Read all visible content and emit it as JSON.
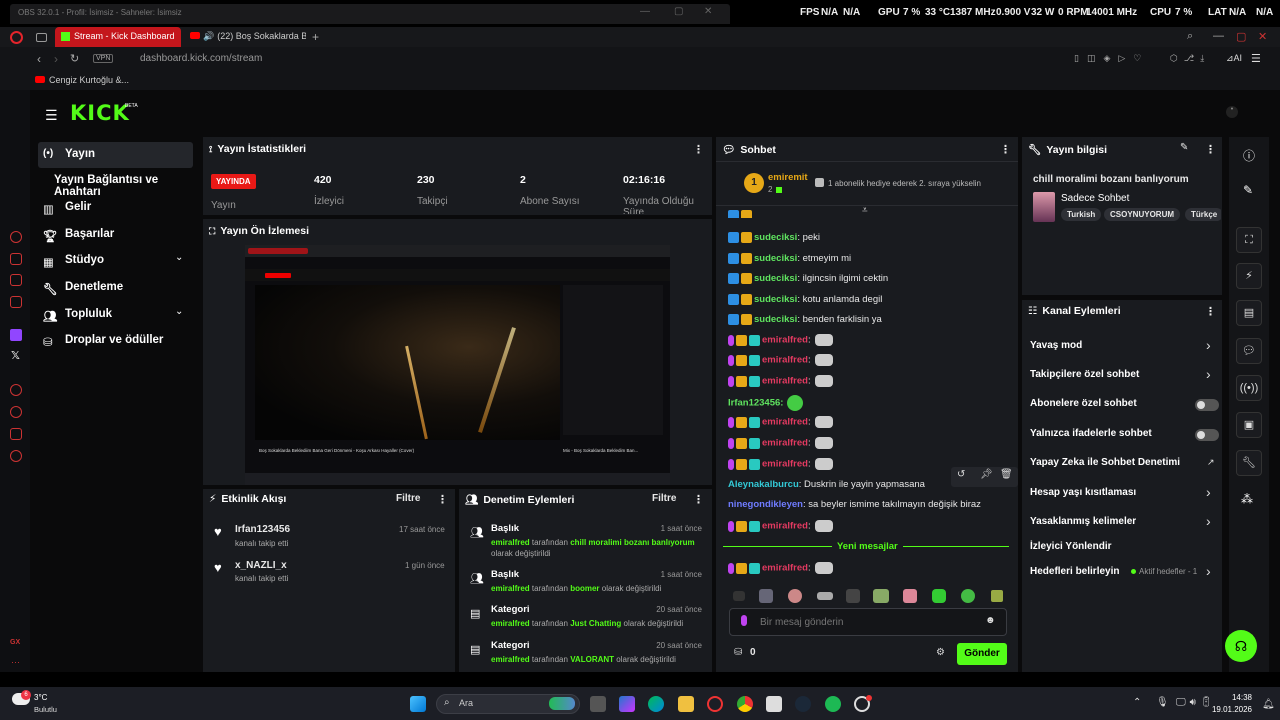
{
  "obs": {
    "title": "OBS 32.0.1 - Profil: İsimsiz - Sahneler: İsimsiz",
    "fps_label": "FPS",
    "fps_val": "N/A",
    "fps_val2": "N/A",
    "gpu_label": "GPU",
    "gpu_pct": "7 %",
    "gpu_temp": "33 °C",
    "gpu_mhz": "1387 MHz",
    "gpu_v": "0.900 V",
    "gpu_w": "32 W",
    "gpu_rpm": "0 RPM",
    "gpu_mhz2": "14001 MHz",
    "cpu_label": "CPU",
    "cpu_pct": "7 %",
    "lat_label": "LAT",
    "lat_val": "N/A",
    "lat_val2": "N/A"
  },
  "browser": {
    "tab1": "Stream - Kick Dashboard",
    "tab2": "(22) Boş Sokaklarda B...",
    "url_vpn": "VPN",
    "url": "dashboard.kick.com/stream",
    "bookmark1": "Cengiz Kurtoğlu &...",
    "ai_label": "AI"
  },
  "kick": {
    "logo": "KICK",
    "beta": "BETA"
  },
  "sidebar": {
    "items": [
      {
        "label": "Yayın"
      },
      {
        "label": "Yayın Bağlantısı ve Anahtarı"
      },
      {
        "label": "Gelir"
      },
      {
        "label": "Başarılar"
      },
      {
        "label": "Stüdyo"
      },
      {
        "label": "Denetleme"
      },
      {
        "label": "Topluluk"
      },
      {
        "label": "Droplar ve ödüller"
      }
    ]
  },
  "stats": {
    "title": "Yayın İstatistikleri",
    "live": "YAYINDA",
    "yayin": "Yayın",
    "viewers": "420",
    "viewers_l": "İzleyici",
    "followers": "230",
    "followers_l": "Takipçi",
    "subs": "2",
    "subs_l": "Abone Sayısı",
    "uptime": "02:16:16",
    "uptime_l": "Yayında Olduğu Süre"
  },
  "preview": {
    "title": "Yayın Ön İzlemesi",
    "video_title": "Boş Sokaklarda Beklediim Bana Geri Dönmeni - Koşu Arkası Hayaller (Cover)",
    "side_title": "Mix - Boş Sokaklarda Bekledim Ban..."
  },
  "activity": {
    "title": "Etkinlik Akışı",
    "filter": "Filtre",
    "items": [
      {
        "user": "Irfan123456",
        "desc": "kanalı takip etti",
        "time": "17 saat önce"
      },
      {
        "user": "x_NAZLI_x",
        "desc": "kanalı takip etti",
        "time": "1 gün önce"
      }
    ]
  },
  "mod": {
    "title": "Denetim Eylemleri",
    "filter": "Filtre",
    "items": [
      {
        "type": "Başlık",
        "time": "1 saat önce",
        "actor": "emiralfred",
        "mid": "tarafından",
        "value": "chill moralimi bozanı banlıyorum",
        "end": "olarak değiştirildi"
      },
      {
        "type": "Başlık",
        "time": "1 saat önce",
        "actor": "emiralfred",
        "mid": "tarafından",
        "value": "boomer",
        "end": "olarak değiştirildi"
      },
      {
        "type": "Kategori",
        "time": "20 saat önce",
        "actor": "emiralfred",
        "mid": "tarafından",
        "value": "Just Chatting",
        "end": "olarak değiştirildi"
      },
      {
        "type": "Kategori",
        "time": "20 saat önce",
        "actor": "emiralfred",
        "mid": "tarafından",
        "value": "VALORANT",
        "end": "olarak değiştirildi"
      }
    ]
  },
  "chat": {
    "title": "Sohbet",
    "pin_user": "emiremit",
    "pin_count": "2",
    "pin_rank": "1",
    "pin_text": "1 abonelik hediye ederek 2. sıraya yükselin",
    "lines": [
      {
        "user": "sudeciksi",
        "text": ": peki"
      },
      {
        "user": "sudeciksi",
        "text": ": etmeyim mi"
      },
      {
        "user": "sudeciksi",
        "text": ": ilgincsin ilgimi cektin"
      },
      {
        "user": "sudeciksi",
        "text": ": kotu anlamda degil"
      },
      {
        "user": "sudeciksi",
        "text": ": benden farklisin ya"
      }
    ],
    "emir": "emiralfred",
    "colon": ":",
    "irfan": "Irfan123456:",
    "aley_user": "Aleynakalburcu",
    "aley_text": ": Duskrin ile yayin yapmasana",
    "nine_user": "ninegondikleyen",
    "nine_text": ": sa beyler ismime takılmayın değişik biraz",
    "new_msgs": "Yeni mesajlar",
    "placeholder": "Bir mesaj gönderin",
    "points": "0",
    "send": "Gönder"
  },
  "info": {
    "title": "Yayın bilgisi",
    "stream_title": "chill moralimi bozanı banlıyorum",
    "category": "Sadece Sohbet",
    "tags": [
      "Turkish",
      "CSOYNUYORUM",
      "Türkçe"
    ]
  },
  "actions": {
    "title": "Kanal Eylemleri",
    "items": [
      "Yavaş mod",
      "Takipçilere özel sohbet",
      "Abonelere özel sohbet",
      "Yalnızca ifadelerle sohbet",
      "Yapay Zeka ile Sohbet Denetimi",
      "Hesap yaşı kısıtlaması",
      "Yasaklanmış kelimeler",
      "İzleyici Yönlendir",
      "Hedefleri belirleyin"
    ],
    "goals": "Aktif hedefler - 1"
  },
  "taskbar": {
    "temp": "3°C",
    "weather": "Bulutlu",
    "search": "Ara",
    "time": "14:38",
    "date": "19.01.2026",
    "badge": "6"
  },
  "colors": {
    "kick_green": "#53fc18",
    "live_red": "#e91916",
    "emir": "#e43a61",
    "suda": "#5fe35f"
  }
}
